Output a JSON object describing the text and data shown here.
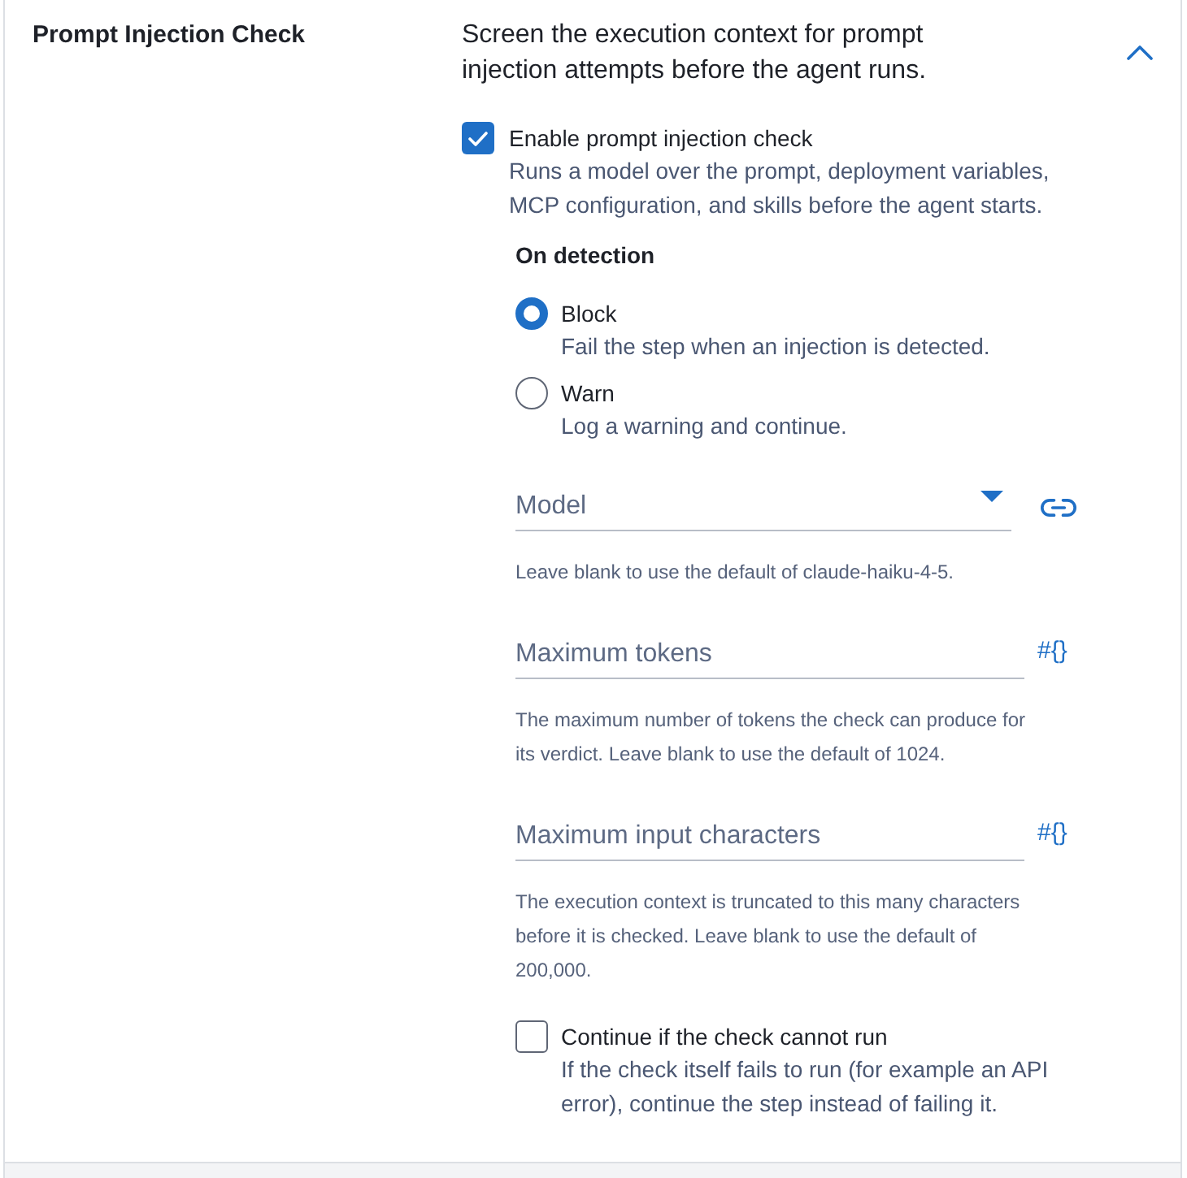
{
  "section": {
    "title": "Prompt Injection Check",
    "description": "Screen the execution context for prompt injection attempts before the agent runs.",
    "expanded": true
  },
  "enable": {
    "label": "Enable prompt injection check",
    "help": "Runs a model over the prompt, deployment variables, MCP configuration, and skills before the agent starts.",
    "checked": true
  },
  "on_detection": {
    "heading": "On detection",
    "options": [
      {
        "label": "Block",
        "help": "Fail the step when an injection is detected.",
        "selected": true
      },
      {
        "label": "Warn",
        "help": "Log a warning and continue.",
        "selected": false
      }
    ]
  },
  "fields": [
    {
      "kind": "select",
      "placeholder": "Model",
      "help": "Leave blank to use the default of claude-haiku-4-5."
    },
    {
      "kind": "expression",
      "placeholder": "Maximum tokens",
      "toggle": "#{}",
      "help": "The maximum number of tokens the check can produce for its verdict. Leave blank to use the default of 1024."
    },
    {
      "kind": "expression",
      "placeholder": "Maximum input characters",
      "toggle": "#{}",
      "help": "The execution context is truncated to this many characters before it is checked. Leave blank to use the default of 200,000."
    }
  ],
  "continue_on_error": {
    "label": "Continue if the check cannot run",
    "help": "If the check itself fails to run (for example an API error), continue the step instead of failing it.",
    "checked": false
  }
}
